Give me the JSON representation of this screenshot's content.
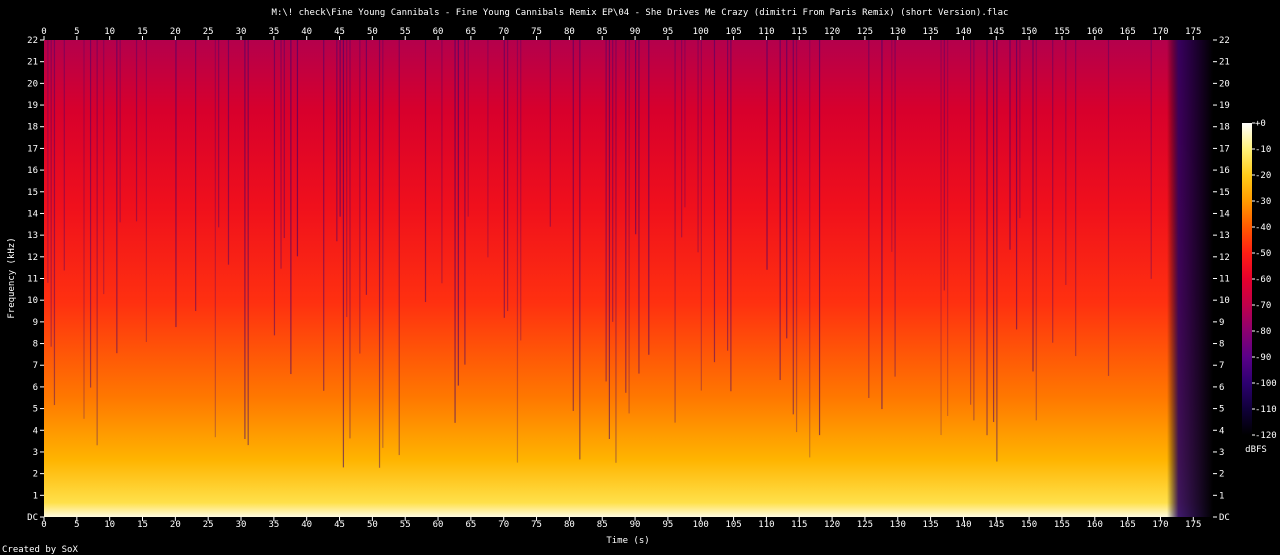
{
  "chart_data": {
    "type": "heatmap",
    "title": "M:\\! check\\Fine Young Cannibals - Fine Young Cannibals Remix EP\\04 - She Drives Me Crazy (dimitri From Paris Remix) (short Version).flac",
    "xlabel": "Time (s)",
    "ylabel": "Frequency (kHz)",
    "xlim": [
      0,
      178
    ],
    "ylim": [
      0,
      22
    ],
    "x_ticks": [
      "0",
      "5",
      "10",
      "15",
      "20",
      "25",
      "30",
      "35",
      "40",
      "45",
      "50",
      "55",
      "60",
      "65",
      "70",
      "75",
      "80",
      "85",
      "90",
      "95",
      "100",
      "105",
      "110",
      "115",
      "120",
      "125",
      "130",
      "135",
      "140",
      "145",
      "150",
      "155",
      "160",
      "165",
      "170",
      "175"
    ],
    "y_ticks": [
      "DC",
      "1",
      "2",
      "3",
      "4",
      "5",
      "6",
      "7",
      "8",
      "9",
      "10",
      "11",
      "12",
      "13",
      "14",
      "15",
      "16",
      "17",
      "18",
      "19",
      "20",
      "21",
      "22"
    ],
    "colorbar": {
      "label": "dBFS",
      "range": [
        -120,
        0
      ],
      "ticks": [
        "+0",
        "-10",
        "-20",
        "-30",
        "-40",
        "-50",
        "-60",
        "-70",
        "-80",
        "-90",
        "-100",
        "-110",
        "-120"
      ],
      "colors": [
        "#ffffff",
        "#fff27a",
        "#ffcc1a",
        "#ff9a00",
        "#ff5a00",
        "#ff1e14",
        "#e6002c",
        "#c0004a",
        "#8c0070",
        "#5a0088",
        "#2d0070",
        "#10003a",
        "#000000"
      ]
    },
    "footer": "Created by SoX",
    "grid": false
  }
}
